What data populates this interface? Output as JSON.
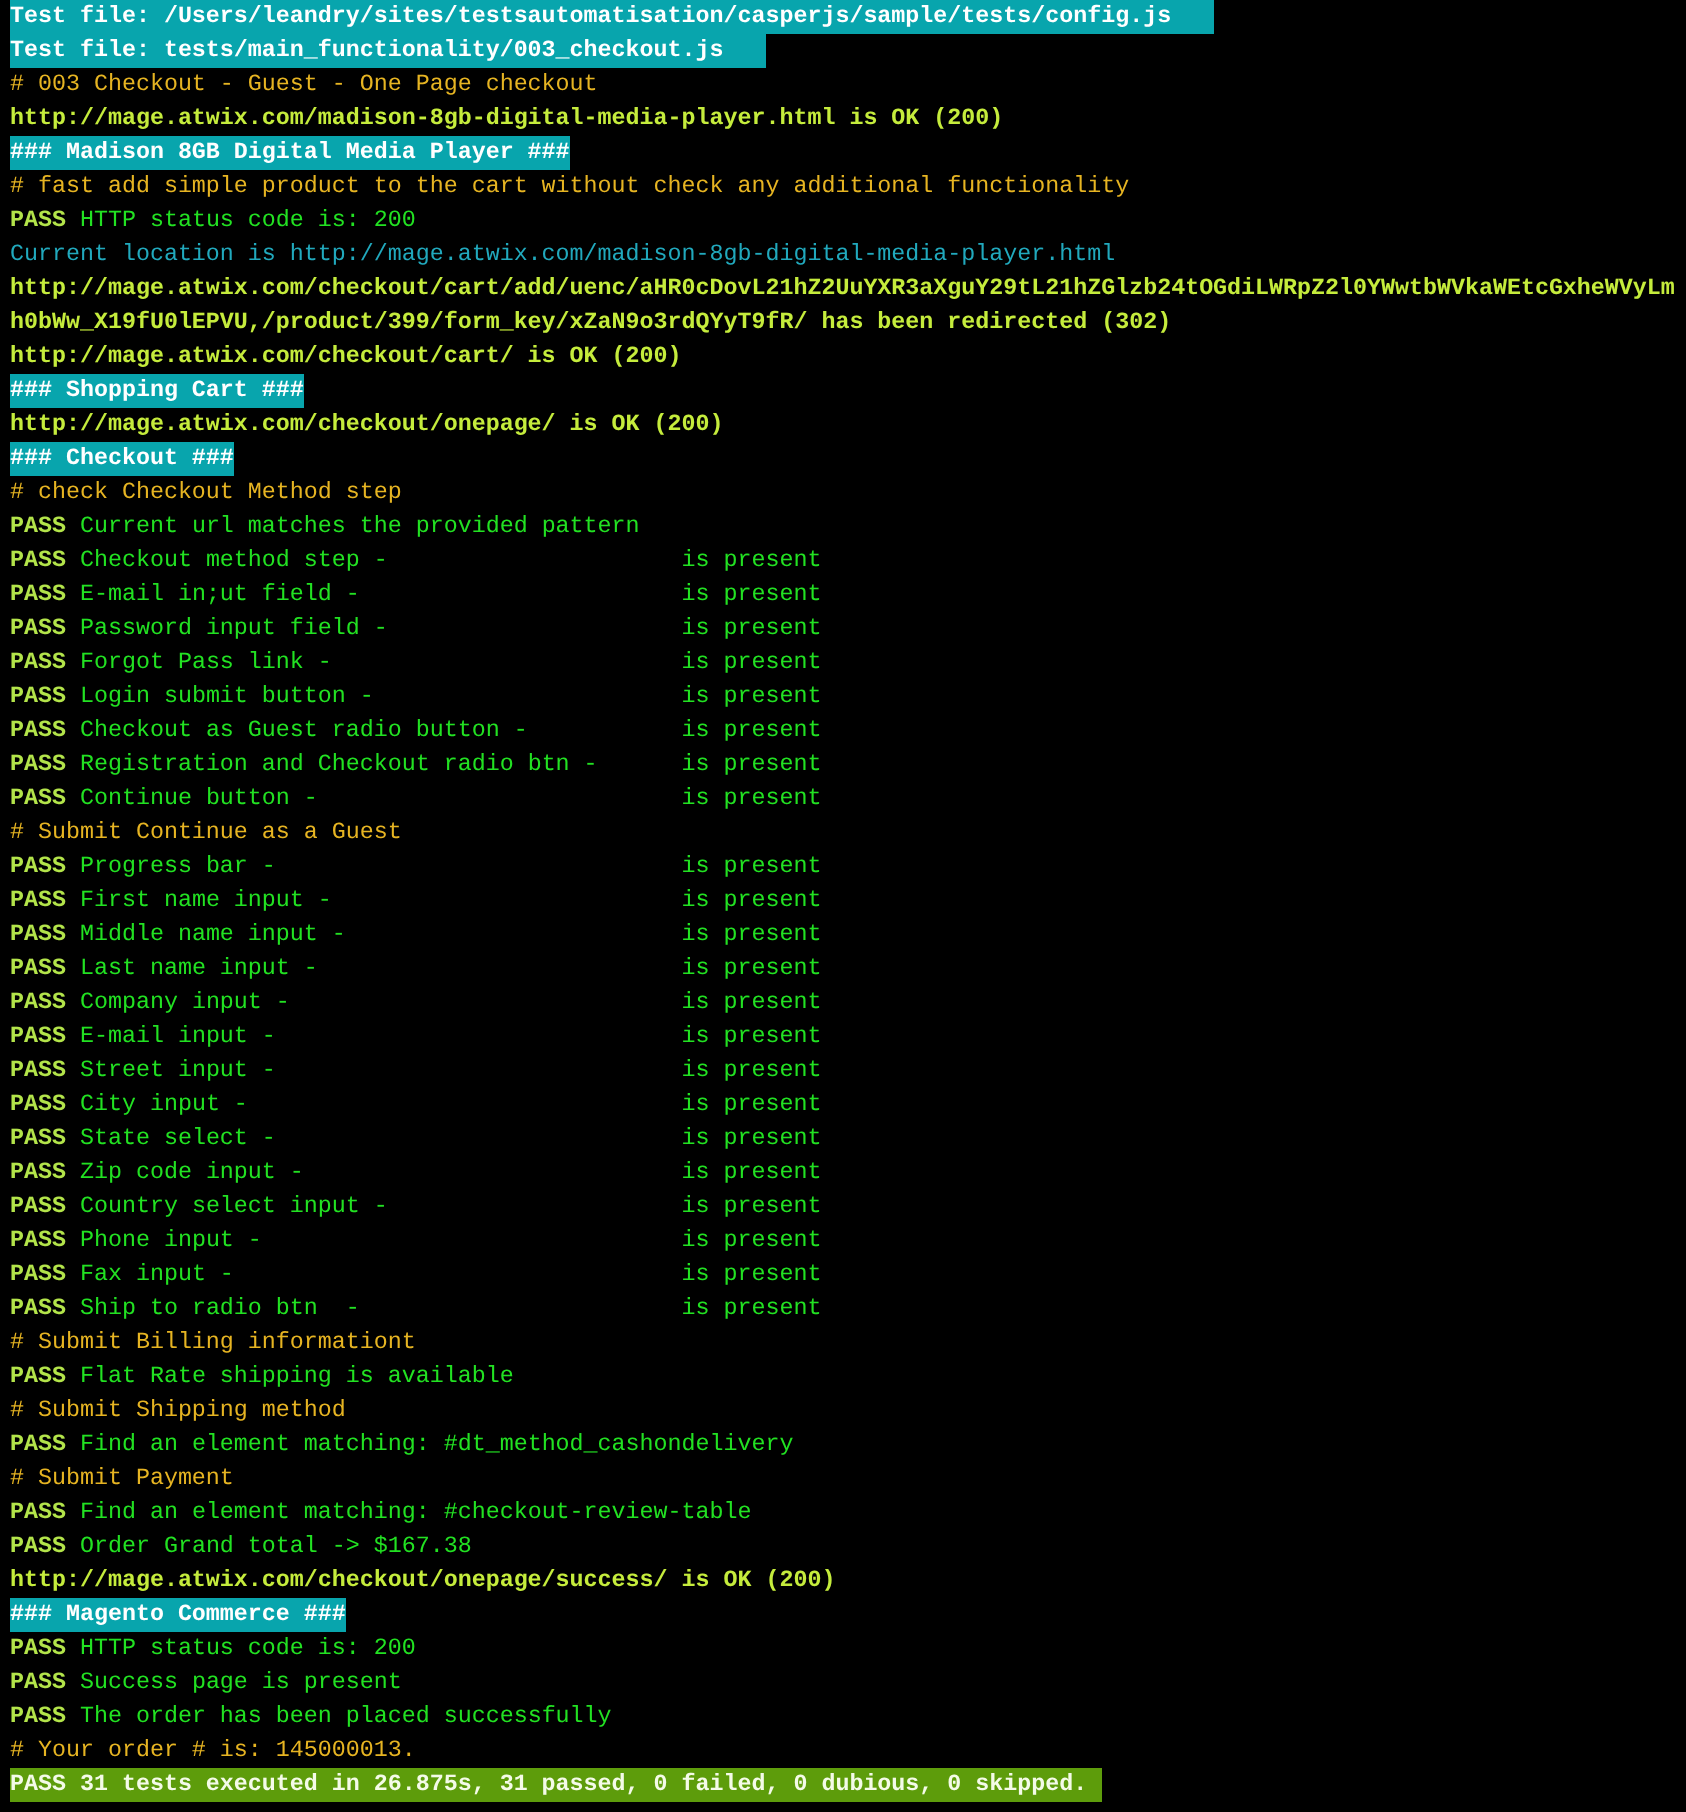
{
  "lines": [
    {
      "kind": "file",
      "text": "Test file: /Users/leandry/sites/testsautomatisation/casperjs/sample/tests/config.js"
    },
    {
      "kind": "file",
      "text": "Test file: tests/main_functionality/003_checkout.js"
    },
    {
      "kind": "comment",
      "text": "# 003 Checkout - Guest - One Page checkout"
    },
    {
      "kind": "url",
      "text": "http://mage.atwix.com/madison-8gb-digital-media-player.html is OK (200)"
    },
    {
      "kind": "header",
      "text": "### Madison 8GB Digital Media Player ###"
    },
    {
      "kind": "comment",
      "text": "# fast add simple product to the cart without check any additional functionality"
    },
    {
      "kind": "pass",
      "status": "PASS",
      "text": "HTTP status code is: 200"
    },
    {
      "kind": "info",
      "text": "Current location is http://mage.atwix.com/madison-8gb-digital-media-player.html"
    },
    {
      "kind": "url",
      "text": "http://mage.atwix.com/checkout/cart/add/uenc/aHR0cDovL21hZ2UuYXR3aXguY29tL21hZGlzb24tOGdiLWRpZ2l0YWwtbWVkaWEtcGxheWVyLmh0bWw_X19fU0lEPVU,/product/399/form_key/xZaN9o3rdQYyT9fR/ has been redirected (302)"
    },
    {
      "kind": "url",
      "text": "http://mage.atwix.com/checkout/cart/ is OK (200)"
    },
    {
      "kind": "header",
      "text": "### Shopping Cart ###"
    },
    {
      "kind": "url",
      "text": "http://mage.atwix.com/checkout/onepage/ is OK (200)"
    },
    {
      "kind": "header",
      "text": "### Checkout ###"
    },
    {
      "kind": "comment",
      "text": "# check Checkout Method step"
    },
    {
      "kind": "pass",
      "status": "PASS",
      "text": "Current url matches the provided pattern"
    },
    {
      "kind": "pass",
      "status": "PASS",
      "text": "Checkout method step -",
      "result": "is present"
    },
    {
      "kind": "pass",
      "status": "PASS",
      "text": "E-mail in;ut field -",
      "result": "is present"
    },
    {
      "kind": "pass",
      "status": "PASS",
      "text": "Password input field -",
      "result": "is present"
    },
    {
      "kind": "pass",
      "status": "PASS",
      "text": "Forgot Pass link -",
      "result": "is present"
    },
    {
      "kind": "pass",
      "status": "PASS",
      "text": "Login submit button -",
      "result": "is present"
    },
    {
      "kind": "pass",
      "status": "PASS",
      "text": "Checkout as Guest radio button -",
      "result": "is present"
    },
    {
      "kind": "pass",
      "status": "PASS",
      "text": "Registration and Checkout radio btn -",
      "result": "is present"
    },
    {
      "kind": "pass",
      "status": "PASS",
      "text": "Continue button -",
      "result": "is present"
    },
    {
      "kind": "comment",
      "text": "# Submit Continue as a Guest"
    },
    {
      "kind": "pass",
      "status": "PASS",
      "text": "Progress bar -",
      "result": "is present"
    },
    {
      "kind": "pass",
      "status": "PASS",
      "text": "First name input -",
      "result": "is present"
    },
    {
      "kind": "pass",
      "status": "PASS",
      "text": "Middle name input -",
      "result": "is present"
    },
    {
      "kind": "pass",
      "status": "PASS",
      "text": "Last name input -",
      "result": "is present"
    },
    {
      "kind": "pass",
      "status": "PASS",
      "text": "Company input -",
      "result": "is present"
    },
    {
      "kind": "pass",
      "status": "PASS",
      "text": "E-mail input -",
      "result": "is present"
    },
    {
      "kind": "pass",
      "status": "PASS",
      "text": "Street input -",
      "result": "is present"
    },
    {
      "kind": "pass",
      "status": "PASS",
      "text": "City input -",
      "result": "is present"
    },
    {
      "kind": "pass",
      "status": "PASS",
      "text": "State select -",
      "result": "is present"
    },
    {
      "kind": "pass",
      "status": "PASS",
      "text": "Zip code input -",
      "result": "is present"
    },
    {
      "kind": "pass",
      "status": "PASS",
      "text": "Country select input -",
      "result": "is present"
    },
    {
      "kind": "pass",
      "status": "PASS",
      "text": "Phone input -",
      "result": "is present"
    },
    {
      "kind": "pass",
      "status": "PASS",
      "text": "Fax input -",
      "result": "is present"
    },
    {
      "kind": "pass",
      "status": "PASS",
      "text": "Ship to radio btn  -",
      "result": "is present"
    },
    {
      "kind": "comment",
      "text": "# Submit Billing informationt"
    },
    {
      "kind": "pass",
      "status": "PASS",
      "text": "Flat Rate shipping is available"
    },
    {
      "kind": "comment",
      "text": "# Submit Shipping method"
    },
    {
      "kind": "pass",
      "status": "PASS",
      "text": "Find an element matching: #dt_method_cashondelivery"
    },
    {
      "kind": "comment",
      "text": "# Submit Payment"
    },
    {
      "kind": "pass",
      "status": "PASS",
      "text": "Find an element matching: #checkout-review-table"
    },
    {
      "kind": "pass",
      "status": "PASS",
      "text": "Order Grand total -> $167.38"
    },
    {
      "kind": "url",
      "text": "http://mage.atwix.com/checkout/onepage/success/ is OK (200)"
    },
    {
      "kind": "header",
      "text": "### Magento Commerce ###"
    },
    {
      "kind": "pass",
      "status": "PASS",
      "text": "HTTP status code is: 200"
    },
    {
      "kind": "pass",
      "status": "PASS",
      "text": "Success page is present"
    },
    {
      "kind": "pass",
      "status": "PASS",
      "text": "The order has been placed successfully"
    },
    {
      "kind": "comment",
      "text": "# Your order # is: 145000013."
    },
    {
      "kind": "summary",
      "text": "PASS 31 tests executed in 26.875s, 31 passed, 0 failed, 0 dubious, 0 skipped."
    }
  ]
}
